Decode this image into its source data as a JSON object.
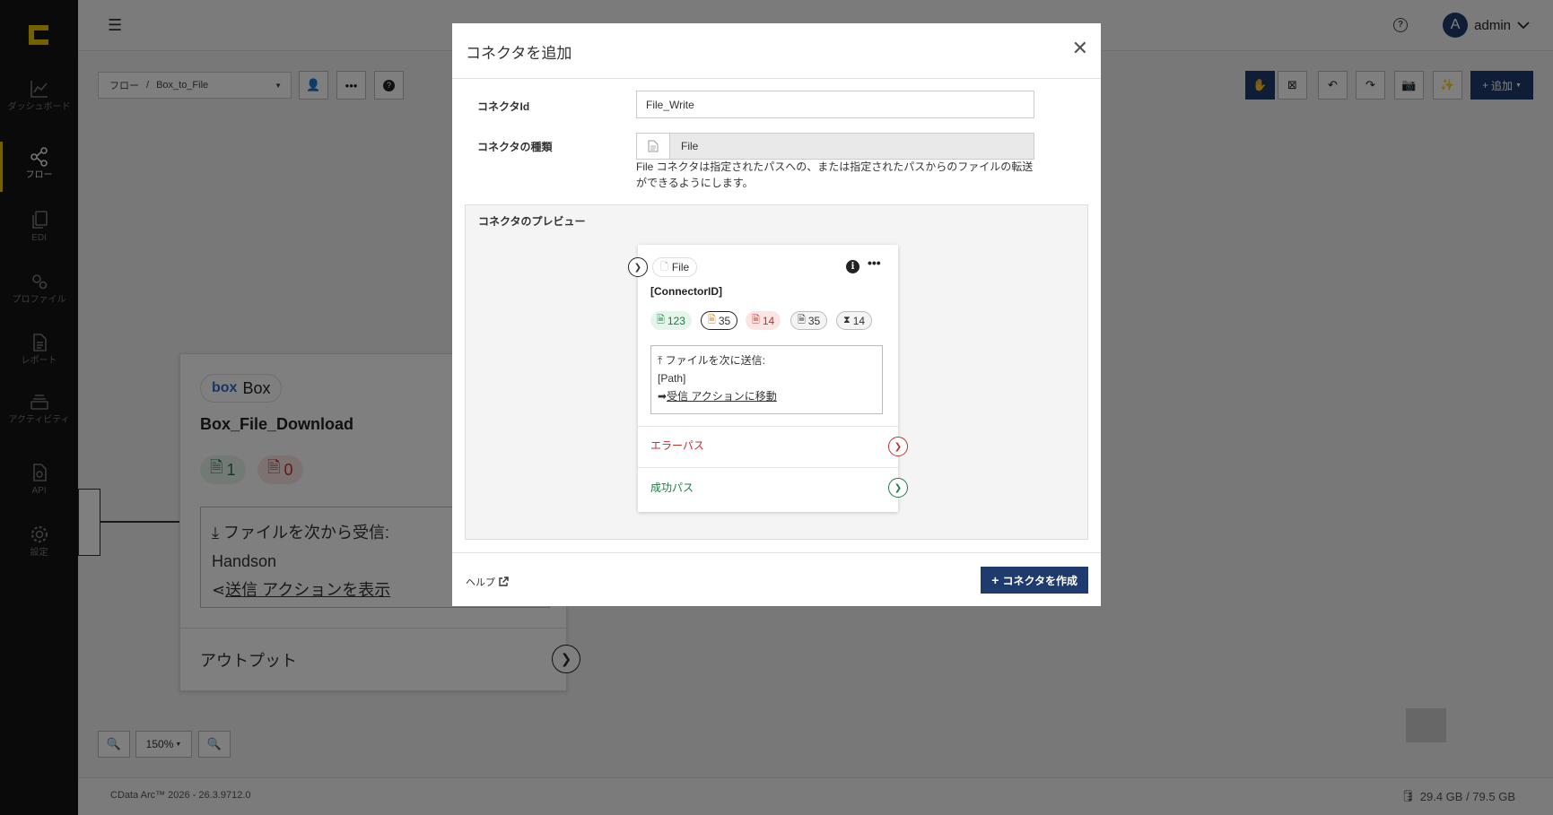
{
  "sidebar": {
    "items": [
      {
        "label": "ダッシュボード",
        "icon": "chart-line-icon"
      },
      {
        "label": "フロー",
        "icon": "share-nodes-icon"
      },
      {
        "label": "EDI",
        "icon": "files-icon"
      },
      {
        "label": "プロファイル",
        "icon": "gears-icon"
      },
      {
        "label": "レポート",
        "icon": "report-icon"
      },
      {
        "label": "アクティビティ",
        "icon": "stack-icon"
      },
      {
        "label": "API",
        "icon": "api-file-icon"
      },
      {
        "label": "設定",
        "icon": "gear-icon"
      }
    ],
    "accent": "#e6c200"
  },
  "topbar": {
    "avatar_letter": "A",
    "user": "admin"
  },
  "toolbar": {
    "breadcrumb_root": "フロー",
    "breadcrumb_sep": "/",
    "breadcrumb_flow": "Box_to_File",
    "add_label": "追加"
  },
  "canvas": {
    "bg_card": {
      "chip_logo": "box",
      "chip_label": "Box",
      "name": "Box_File_Download",
      "success_count": "1",
      "error_count": "0",
      "receive_label": "ファイルを次から受信:",
      "receive_value": "Handson",
      "send_link": "送信 アクションを表示",
      "output_label": "アウトプット"
    },
    "zoom_level": "150%"
  },
  "footer": {
    "version": "CData Arc™ 2026 - 26.3.9712.0",
    "storage": "29.4 GB / 79.5 GB"
  },
  "modal": {
    "title": "コネクタを追加",
    "id_label": "コネクタId",
    "id_value": "File_Write",
    "type_label": "コネクタの種類",
    "type_value": "File",
    "type_description": "File コネクタは指定されたパスへの、または指定されたパスからのファイルの転送ができるようにします。",
    "preview_label": "コネクタのプレビュー",
    "preview": {
      "chip_label": "File",
      "connector_id": "[ConnectorID]",
      "badges": [
        "123",
        "35",
        "14",
        "35",
        "14"
      ],
      "send_label": "ファイルを次に送信:",
      "path_value": "[Path]",
      "receive_link": "受信 アクションに移動",
      "error_path": "エラーパス",
      "success_path": "成功パス"
    },
    "help_label": "ヘルプ",
    "create_label": "コネクタを作成"
  },
  "colors": {
    "primary": "#1f3a6d",
    "success": "#1e7a45",
    "error": "#c03232"
  }
}
